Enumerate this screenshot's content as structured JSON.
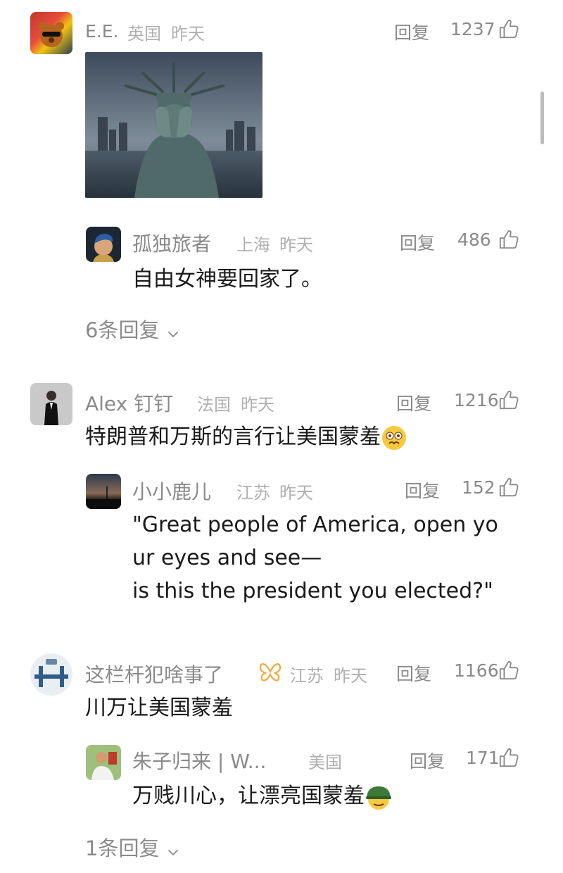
{
  "colors": {
    "text_primary": "#1a1a1a",
    "text_secondary": "#8a8a8a",
    "text_meta": "#b0b0b0",
    "background": "#ffffff"
  },
  "comments": [
    {
      "user": "E.E.",
      "location": "英国",
      "time": "昨天",
      "reply_label": "回复",
      "likes": "1237",
      "image": {
        "subject": "Statue of Liberty covering face with hands"
      },
      "replies": [
        {
          "user": "孤独旅者",
          "location": "上海",
          "time": "昨天",
          "reply_label": "回复",
          "likes": "486",
          "text": "自由女神要回家了。"
        }
      ],
      "more_replies": "6条回复"
    },
    {
      "user": "Alex 钉钉",
      "location": "法国",
      "time": "昨天",
      "reply_label": "回复",
      "likes": "1216",
      "text": "特朗普和万斯的言行让美国蒙羞",
      "replies": [
        {
          "user": "小小鹿儿",
          "location": "江苏",
          "time": "昨天",
          "reply_label": "回复",
          "likes": "152",
          "text_lines": [
            "\"Great people of America, open yo",
            "ur eyes and see—",
            "is this the president you elected?\""
          ]
        }
      ]
    },
    {
      "user": "这栏杆犯啥事了",
      "location": "江苏",
      "time": "昨天",
      "reply_label": "回复",
      "likes": "1166",
      "text": "川万让美国蒙羞",
      "replies": [
        {
          "user": "朱子归来 | W...",
          "location": "美国",
          "reply_label": "回复",
          "likes": "171",
          "text": "万贱川心，让漂亮国蒙羞"
        }
      ],
      "more_replies": "1条回复"
    }
  ],
  "icons": {
    "like": "thumbs-up-icon",
    "chevron": "chevron-down-icon"
  }
}
